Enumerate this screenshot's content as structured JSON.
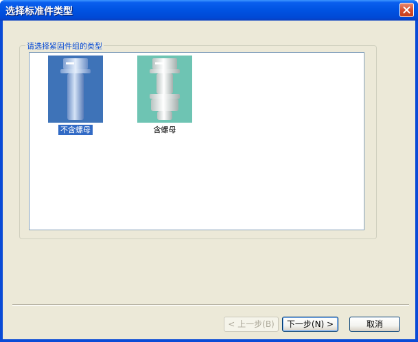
{
  "window": {
    "title": "选择标准件类型",
    "close_icon": "close-icon",
    "titlebar_color": "#0054e3",
    "close_color": "#d9502e"
  },
  "group": {
    "label": "请选择紧固件组的类型"
  },
  "items": [
    {
      "label": "不含螺母",
      "icon": "bolt-without-nut-icon",
      "selected": true
    },
    {
      "label": "含螺母",
      "icon": "bolt-with-nut-icon",
      "selected": false
    }
  ],
  "buttons": {
    "back": "< 上一步(B)",
    "next": "下一步(N) >",
    "cancel": "取消"
  }
}
